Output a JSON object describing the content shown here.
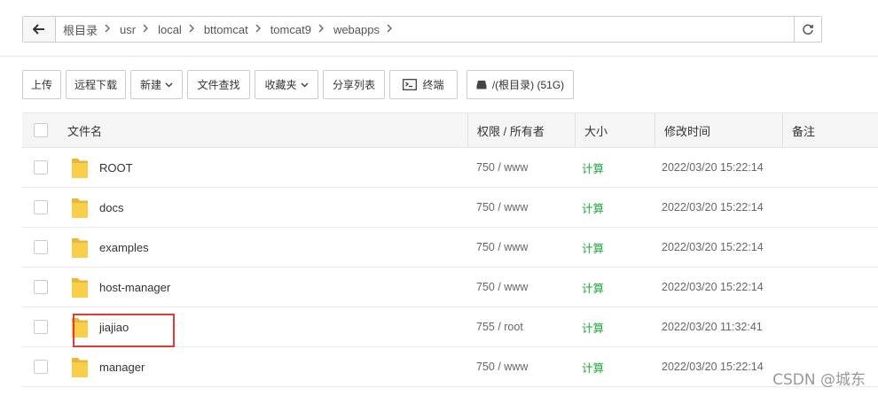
{
  "nav": {
    "back_icon": "arrow-left-icon",
    "refresh_icon": "refresh-icon",
    "breadcrumbs": [
      {
        "label": "根目录"
      },
      {
        "label": "usr"
      },
      {
        "label": "local"
      },
      {
        "label": "bttomcat"
      },
      {
        "label": "tomcat9"
      },
      {
        "label": "webapps"
      }
    ]
  },
  "toolbar": {
    "upload": "上传",
    "remote_download": "远程下载",
    "new": "新建",
    "file_search": "文件查找",
    "favorites": "收藏夹",
    "share_list": "分享列表",
    "terminal": "终端",
    "disk": "/(根目录) (51G)"
  },
  "table": {
    "headers": {
      "name": "文件名",
      "perm": "权限 / 所有者",
      "size": "大小",
      "mtime": "修改时间",
      "note": "备注"
    },
    "rows": [
      {
        "name": "ROOT",
        "perm": "750 / www",
        "size": "计算",
        "mtime": "2022/03/20 15:22:14"
      },
      {
        "name": "docs",
        "perm": "750 / www",
        "size": "计算",
        "mtime": "2022/03/20 15:22:14"
      },
      {
        "name": "examples",
        "perm": "750 / www",
        "size": "计算",
        "mtime": "2022/03/20 15:22:14"
      },
      {
        "name": "host-manager",
        "perm": "750 / www",
        "size": "计算",
        "mtime": "2022/03/20 15:22:14"
      },
      {
        "name": "jiajiao",
        "perm": "755 / root",
        "size": "计算",
        "mtime": "2022/03/20 11:32:41"
      },
      {
        "name": "manager",
        "perm": "750 / www",
        "size": "计算",
        "mtime": "2022/03/20 15:22:14"
      }
    ]
  },
  "colors": {
    "accent_green": "#20a53a",
    "highlight_red": "#e53935",
    "folder_yellow": "#f9cf4a"
  },
  "watermark": "CSDN @城东"
}
